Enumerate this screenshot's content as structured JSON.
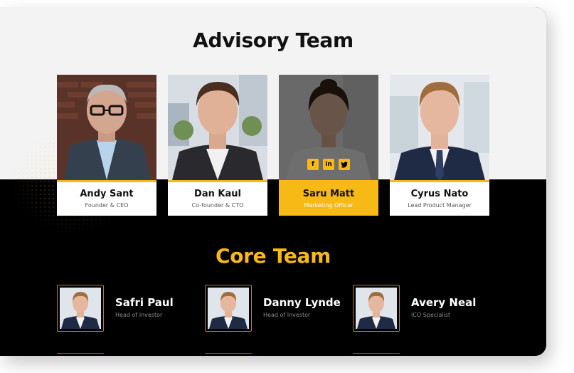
{
  "advisory": {
    "title": "Advisory Team",
    "members": [
      {
        "name": "Andy Sant",
        "role": "Founder & CEO"
      },
      {
        "name": "Dan Kaul",
        "role": "Co-founder & CTO"
      },
      {
        "name": "Saru Matt",
        "role": "Marketing Officer",
        "active": true
      },
      {
        "name": "Cyrus Nato",
        "role": "Lead Product Manager"
      }
    ],
    "socials": [
      {
        "icon": "facebook-icon",
        "glyph": "f"
      },
      {
        "icon": "linkedin-icon",
        "glyph": "in"
      },
      {
        "icon": "twitter-icon",
        "glyph": "t"
      }
    ]
  },
  "core": {
    "title": "Core Team",
    "members": [
      {
        "name": "Safri Paul",
        "role": "Head of Investor"
      },
      {
        "name": "Danny Lynde",
        "role": "Head of Investor"
      },
      {
        "name": "Avery Neal",
        "role": "ICO Specialist"
      }
    ]
  },
  "colors": {
    "accent": "#f7b916",
    "dark": "#000000",
    "light": "#f3f3f3"
  }
}
